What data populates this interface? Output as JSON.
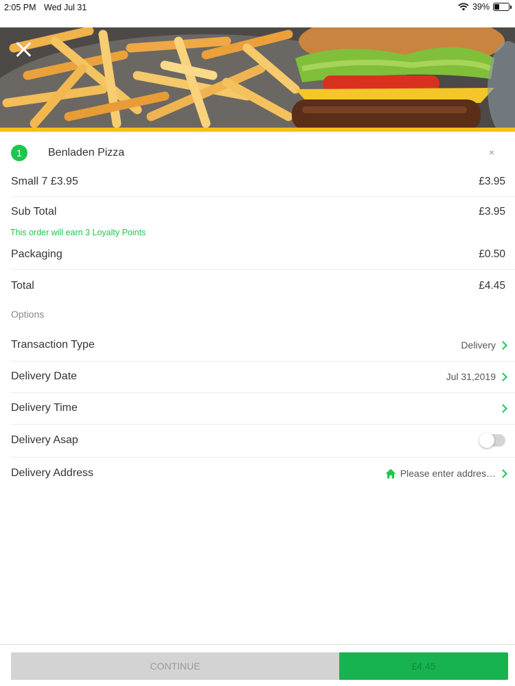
{
  "status_bar": {
    "time": "2:05 PM",
    "date": "Wed Jul 31",
    "battery": "39%",
    "battery_level": 0.39
  },
  "cart": {
    "item": {
      "quantity": "1",
      "name": "Benladen Pizza",
      "remove": "×"
    },
    "size_line": {
      "label": "Small 7 £3.95",
      "price": "£3.95"
    },
    "subtotal": {
      "label": "Sub Total",
      "value": "£3.95"
    },
    "loyalty_text": "This order will earn 3 Loyalty Points",
    "packaging": {
      "label": "Packaging",
      "value": "£0.50"
    },
    "total": {
      "label": "Total",
      "value": "£4.45"
    }
  },
  "options": {
    "heading": "Options",
    "transaction_type": {
      "label": "Transaction Type",
      "value": "Delivery"
    },
    "delivery_date": {
      "label": "Delivery Date",
      "value": "Jul 31,2019"
    },
    "delivery_time": {
      "label": "Delivery Time",
      "value": ""
    },
    "delivery_asap": {
      "label": "Delivery Asap",
      "enabled": false
    },
    "delivery_address": {
      "label": "Delivery Address",
      "placeholder": "Please enter addres…"
    }
  },
  "footer": {
    "continue_label": "CONTINUE",
    "total_label": "£4.45"
  },
  "icons": {
    "close": "close-icon",
    "chevron": "chevron-right-icon",
    "home": "home-icon",
    "wifi": "wifi-icon",
    "battery": "battery-icon"
  },
  "colors": {
    "accent_green": "#1ec64e",
    "button_green": "#17b350",
    "hero_bar_yellow": "#f5c017",
    "disabled_gray": "#d3d3d3"
  }
}
